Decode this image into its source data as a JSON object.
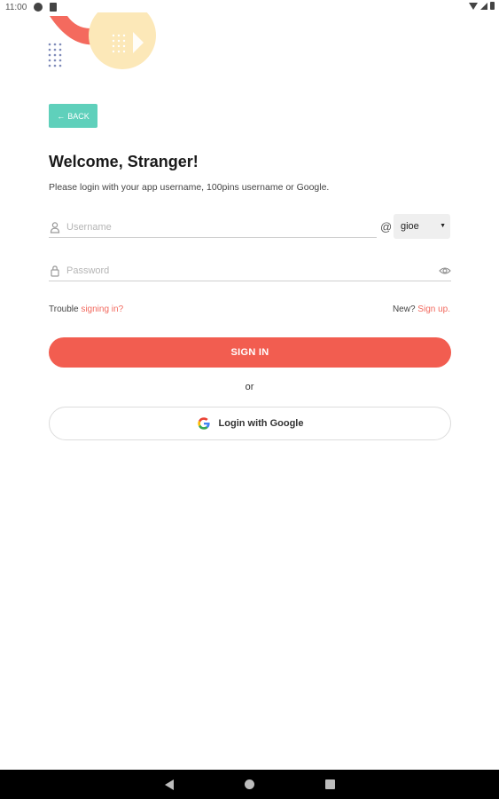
{
  "status_bar": {
    "time": "11:00"
  },
  "back_button": {
    "label": "BACK"
  },
  "header": {
    "title": "Welcome, Stranger!",
    "subtitle": "Please login with your app username, 100pins username or Google."
  },
  "form": {
    "username_placeholder": "Username",
    "at": "@",
    "domain_value": "gioe",
    "password_placeholder": "Password"
  },
  "links": {
    "trouble_prefix": "Trouble ",
    "trouble_link": "signing in?",
    "new_prefix": "New? ",
    "signup_link": "Sign up."
  },
  "actions": {
    "sign_in_label": "SIGN IN",
    "or_label": "or",
    "google_label": "Login with Google"
  },
  "colors": {
    "accent": "#f25d50",
    "back_button": "#5fd0bb",
    "link": "#f2695e"
  },
  "icons": {
    "username": "user-icon",
    "password": "lock-icon",
    "visibility": "eye-icon",
    "back": "arrow-left-icon",
    "google": "google-icon"
  }
}
